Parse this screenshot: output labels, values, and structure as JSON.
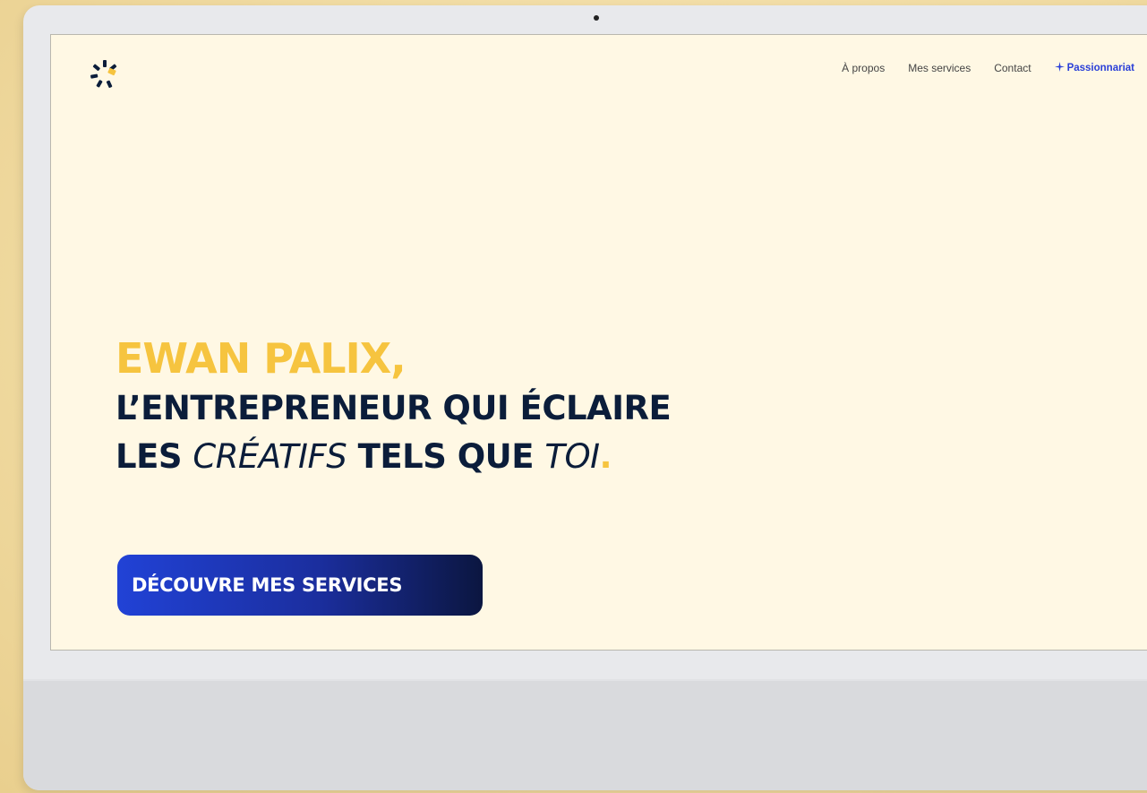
{
  "nav": {
    "items": [
      {
        "label": "À propos"
      },
      {
        "label": "Mes services"
      },
      {
        "label": "Contact"
      }
    ],
    "cta": {
      "label": "Passionnariat",
      "icon": "sparkle-icon"
    }
  },
  "hero": {
    "line1": "EWAN PALIX,",
    "line2": "L’ENTREPRENEUR QUI ÉCLAIRE",
    "line3_a": "LES ",
    "line3_b": "CRÉATIFS",
    "line3_c": " TELS QUE ",
    "line3_d": "TOI",
    "line3_e": "."
  },
  "button": {
    "label": "DÉCOUVRE MES SERVICES"
  },
  "colors": {
    "accent_yellow": "#f6c43f",
    "navy": "#0b1d3a",
    "blue": "#2142d6",
    "background": "#fff8e4"
  },
  "logo": {
    "icon": "sunburst-logo-icon"
  }
}
